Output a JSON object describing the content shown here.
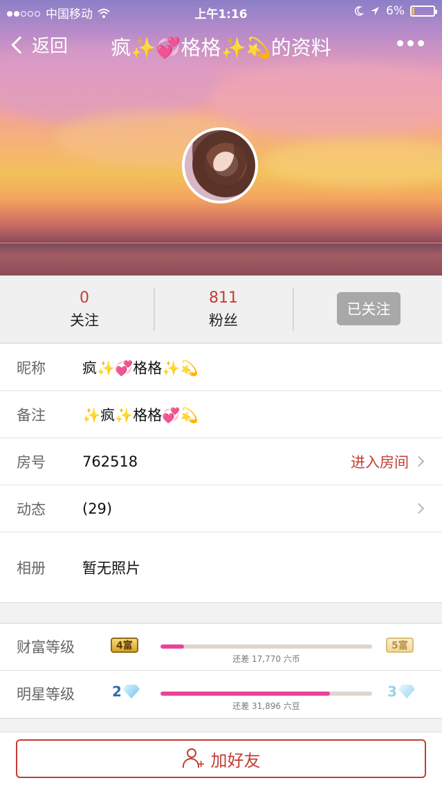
{
  "status_bar": {
    "carrier": "中国移动",
    "time": "上午1:16",
    "battery": "6%",
    "signal_icon": "signal-dots-icon",
    "wifi_icon": "wifi-icon"
  },
  "nav": {
    "back_label": "返回",
    "title": "疯✨💞格格✨💫的资料"
  },
  "stats": {
    "following_count": "0",
    "following_label": "关注",
    "fans_count": "811",
    "fans_label": "粉丝",
    "follow_button": "已关注"
  },
  "info": {
    "nickname_key": "昵称",
    "nickname_value": "疯✨💞格格✨💫",
    "remark_key": "备注",
    "remark_value": "✨疯✨格格💞💫",
    "room_key": "房号",
    "room_value": "762518",
    "room_action": "进入房间",
    "feed_key": "动态",
    "feed_value": "(29)",
    "album_key": "相册",
    "album_value": "暂无照片"
  },
  "levels": {
    "wealth_key": "财富等级",
    "wealth_current": "4富",
    "wealth_next": "5富",
    "wealth_progress": 0.11,
    "wealth_note": "还差 17,770 六币",
    "star_key": "明星等级",
    "star_current": "2",
    "star_next": "3",
    "star_progress": 0.8,
    "star_note": "还差 31,896 六豆"
  },
  "bottom": {
    "add_friend": "加好友"
  },
  "colors": {
    "accent_red": "#c33c32",
    "progress_pink": "#e9439b"
  }
}
